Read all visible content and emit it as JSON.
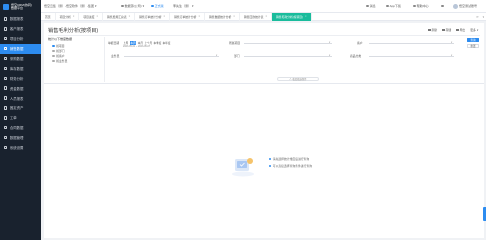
{
  "app": {
    "logo_text_1": "悟空CRM(协同)",
    "logo_text_2": "数据平台"
  },
  "sidebar": {
    "items": [
      {
        "label": "数据报表",
        "icon": "chart-icon"
      },
      {
        "label": "客户报表",
        "icon": "users-icon"
      },
      {
        "label": "项目分析",
        "icon": "project-icon"
      },
      {
        "label": "销售数据",
        "icon": "sales-icon",
        "active": true
      },
      {
        "label": "采购数据",
        "icon": "purchase-icon"
      },
      {
        "label": "库存数据",
        "icon": "stock-icon"
      },
      {
        "label": "财务分析",
        "icon": "finance-icon"
      },
      {
        "label": "资金数据",
        "icon": "fund-icon"
      },
      {
        "label": "人员报表",
        "icon": "person-icon"
      },
      {
        "label": "固定资产",
        "icon": "asset-icon"
      },
      {
        "label": "工单",
        "icon": "ticket-icon"
      },
      {
        "label": "合同数据",
        "icon": "contract-icon"
      },
      {
        "label": "数据管理",
        "icon": "manage-icon"
      },
      {
        "label": "系统设置",
        "icon": "settings-icon"
      }
    ]
  },
  "topbar": {
    "company": "悟空云集（测）-悟空软件（测）-集团",
    "account": "数据源(公司)",
    "env": "正式版",
    "user_short": "李先生（测）",
    "mail": "消息",
    "app_download": "App下载",
    "help": "帮助中心",
    "username": "悟空测试账号"
  },
  "tabs": [
    {
      "label": "首页"
    },
    {
      "label": "项目分析"
    },
    {
      "label": "项目进度"
    },
    {
      "label": "销售费用汇总表"
    },
    {
      "label": "销售订单统计分析"
    },
    {
      "label": "销售订单统计分析"
    },
    {
      "label": "销售数据统计分析"
    },
    {
      "label": "销售回款统计表"
    },
    {
      "label": "销售毛利分析(按项目)",
      "active": true
    }
  ],
  "page": {
    "title": "销售毛利分析(按项目)"
  },
  "actions": {
    "refresh": "刷新",
    "save": "存储",
    "export": "导出",
    "more": "更多"
  },
  "dimensions": {
    "title": "统计以下维度数据",
    "items": [
      {
        "label": "按项目",
        "selected": true
      },
      {
        "label": "按部门",
        "selected": false
      },
      {
        "label": "按客户",
        "selected": false
      },
      {
        "label": "按业务员",
        "selected": false
      }
    ]
  },
  "filters": {
    "date_label": "单据日期",
    "periods": [
      "上周",
      "本周",
      "本月",
      "上个月",
      "本季度",
      "本年度"
    ],
    "active_period": "本周",
    "date_range": "2023-05-01 ~ 2023-05-07",
    "project_label": "所属项目",
    "customer_label": "客户",
    "org_label": "业务员",
    "dept_label": "部门",
    "warehouse_label": "商品分类",
    "query_btn": "查询",
    "reset_btn": "重置",
    "collapse": "∧ 收起筛选条件"
  },
  "empty": {
    "line1": "请先选择统计维度后进行查询",
    "line2": "可以直接选择查询条件进行查询"
  }
}
